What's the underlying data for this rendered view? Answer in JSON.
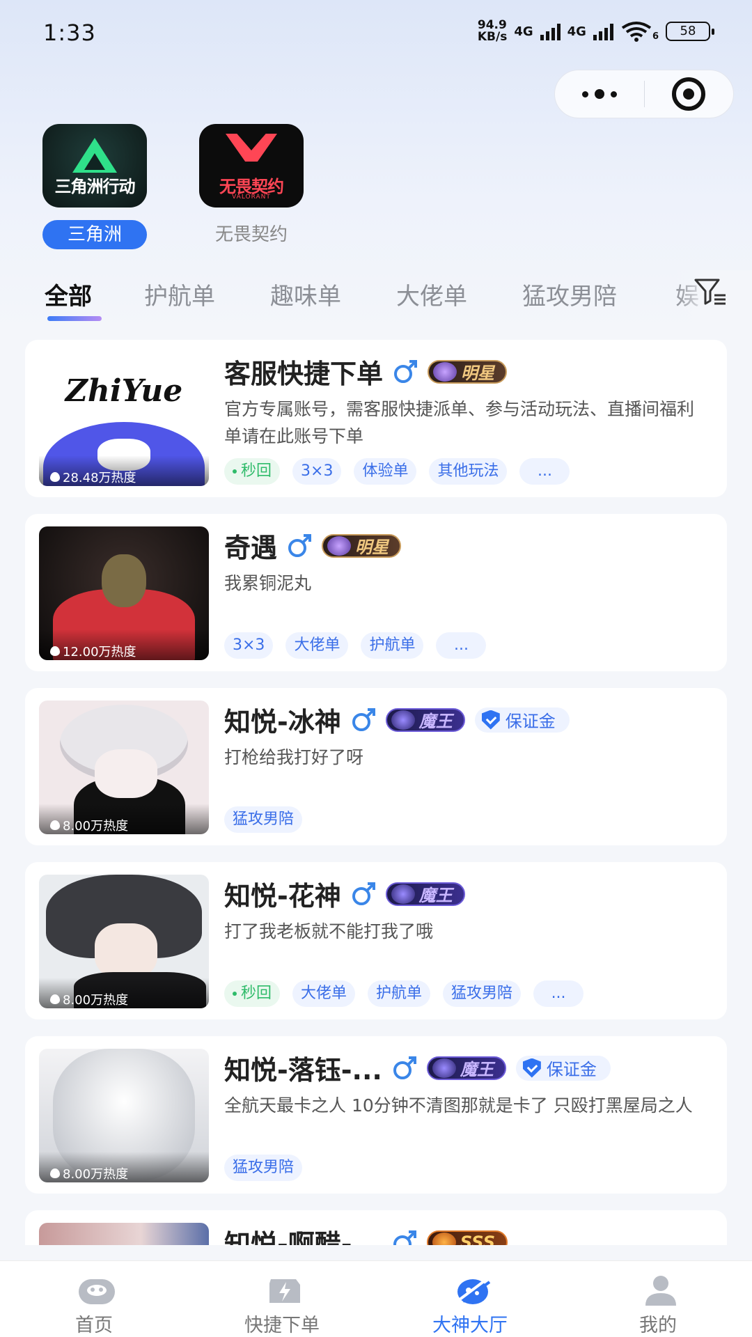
{
  "status_bar": {
    "time": "1:33",
    "net_speed": "94.9",
    "net_unit": "KB/s",
    "sig1": "4G",
    "sig2": "4G",
    "wifi_tag": "6",
    "battery": "58"
  },
  "games": [
    {
      "label": "三角洲",
      "logo_text": "三角洲行动",
      "active": true
    },
    {
      "label": "无畏契约",
      "logo_text": "无畏契约",
      "logo_sub": "VALORANT",
      "active": false
    }
  ],
  "tabs": [
    "全部",
    "护航单",
    "趣味单",
    "大佬单",
    "猛攻男陪",
    "娱"
  ],
  "cards": [
    {
      "name": "客服快捷下单",
      "badge": "明星",
      "heat": "28.48万热度",
      "avatar_text": "ZhiYue",
      "desc": "官方专属账号，需客服快捷派单、参与活动玩法、直播间福利单请在此账号下单",
      "tags": [
        "秒回",
        "3×3",
        "体验单",
        "其他玩法",
        "..."
      ]
    },
    {
      "name": "奇遇",
      "badge": "明星",
      "heat": "12.00万热度",
      "desc": "我累铜泥丸",
      "tags": [
        "3×3",
        "大佬单",
        "护航单",
        "..."
      ]
    },
    {
      "name": "知悦-冰神",
      "badge": "魔王",
      "deposit": "保证金",
      "heat": "8.00万热度",
      "desc": "打枪给我打好了呀",
      "tags": [
        "猛攻男陪"
      ]
    },
    {
      "name": "知悦-花神",
      "badge": "魔王",
      "heat": "8.00万热度",
      "desc": "打了我老板就不能打我了哦",
      "tags": [
        "秒回",
        "大佬单",
        "护航单",
        "猛攻男陪",
        "..."
      ]
    },
    {
      "name": "知悦-落钰-...",
      "badge": "魔王",
      "deposit": "保证金",
      "heat": "8.00万热度",
      "desc": "全航天最卡之人 10分钟不清图那就是卡了 只殴打黑屋局之人",
      "tags": [
        "猛攻男陪"
      ]
    },
    {
      "name": "知悦-啊醋-...",
      "badge": "SSS"
    }
  ],
  "bottom_nav": [
    {
      "label": "首页",
      "icon": "home-icon"
    },
    {
      "label": "快捷下单",
      "icon": "quick-order-icon"
    },
    {
      "label": "大神大厅",
      "icon": "master-hall-icon",
      "active": true
    },
    {
      "label": "我的",
      "icon": "profile-icon"
    }
  ],
  "colors": {
    "accent": "#2f73f2",
    "quick_green": "#2fbb6a"
  }
}
